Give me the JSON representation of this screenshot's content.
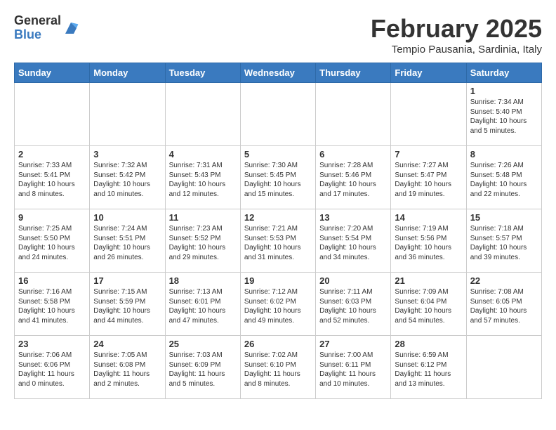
{
  "header": {
    "logo_general": "General",
    "logo_blue": "Blue",
    "month_title": "February 2025",
    "location": "Tempio Pausania, Sardinia, Italy"
  },
  "weekdays": [
    "Sunday",
    "Monday",
    "Tuesday",
    "Wednesday",
    "Thursday",
    "Friday",
    "Saturday"
  ],
  "weeks": [
    [
      {
        "day": "",
        "info": ""
      },
      {
        "day": "",
        "info": ""
      },
      {
        "day": "",
        "info": ""
      },
      {
        "day": "",
        "info": ""
      },
      {
        "day": "",
        "info": ""
      },
      {
        "day": "",
        "info": ""
      },
      {
        "day": "1",
        "info": "Sunrise: 7:34 AM\nSunset: 5:40 PM\nDaylight: 10 hours and 5 minutes."
      }
    ],
    [
      {
        "day": "2",
        "info": "Sunrise: 7:33 AM\nSunset: 5:41 PM\nDaylight: 10 hours and 8 minutes."
      },
      {
        "day": "3",
        "info": "Sunrise: 7:32 AM\nSunset: 5:42 PM\nDaylight: 10 hours and 10 minutes."
      },
      {
        "day": "4",
        "info": "Sunrise: 7:31 AM\nSunset: 5:43 PM\nDaylight: 10 hours and 12 minutes."
      },
      {
        "day": "5",
        "info": "Sunrise: 7:30 AM\nSunset: 5:45 PM\nDaylight: 10 hours and 15 minutes."
      },
      {
        "day": "6",
        "info": "Sunrise: 7:28 AM\nSunset: 5:46 PM\nDaylight: 10 hours and 17 minutes."
      },
      {
        "day": "7",
        "info": "Sunrise: 7:27 AM\nSunset: 5:47 PM\nDaylight: 10 hours and 19 minutes."
      },
      {
        "day": "8",
        "info": "Sunrise: 7:26 AM\nSunset: 5:48 PM\nDaylight: 10 hours and 22 minutes."
      }
    ],
    [
      {
        "day": "9",
        "info": "Sunrise: 7:25 AM\nSunset: 5:50 PM\nDaylight: 10 hours and 24 minutes."
      },
      {
        "day": "10",
        "info": "Sunrise: 7:24 AM\nSunset: 5:51 PM\nDaylight: 10 hours and 26 minutes."
      },
      {
        "day": "11",
        "info": "Sunrise: 7:23 AM\nSunset: 5:52 PM\nDaylight: 10 hours and 29 minutes."
      },
      {
        "day": "12",
        "info": "Sunrise: 7:21 AM\nSunset: 5:53 PM\nDaylight: 10 hours and 31 minutes."
      },
      {
        "day": "13",
        "info": "Sunrise: 7:20 AM\nSunset: 5:54 PM\nDaylight: 10 hours and 34 minutes."
      },
      {
        "day": "14",
        "info": "Sunrise: 7:19 AM\nSunset: 5:56 PM\nDaylight: 10 hours and 36 minutes."
      },
      {
        "day": "15",
        "info": "Sunrise: 7:18 AM\nSunset: 5:57 PM\nDaylight: 10 hours and 39 minutes."
      }
    ],
    [
      {
        "day": "16",
        "info": "Sunrise: 7:16 AM\nSunset: 5:58 PM\nDaylight: 10 hours and 41 minutes."
      },
      {
        "day": "17",
        "info": "Sunrise: 7:15 AM\nSunset: 5:59 PM\nDaylight: 10 hours and 44 minutes."
      },
      {
        "day": "18",
        "info": "Sunrise: 7:13 AM\nSunset: 6:01 PM\nDaylight: 10 hours and 47 minutes."
      },
      {
        "day": "19",
        "info": "Sunrise: 7:12 AM\nSunset: 6:02 PM\nDaylight: 10 hours and 49 minutes."
      },
      {
        "day": "20",
        "info": "Sunrise: 7:11 AM\nSunset: 6:03 PM\nDaylight: 10 hours and 52 minutes."
      },
      {
        "day": "21",
        "info": "Sunrise: 7:09 AM\nSunset: 6:04 PM\nDaylight: 10 hours and 54 minutes."
      },
      {
        "day": "22",
        "info": "Sunrise: 7:08 AM\nSunset: 6:05 PM\nDaylight: 10 hours and 57 minutes."
      }
    ],
    [
      {
        "day": "23",
        "info": "Sunrise: 7:06 AM\nSunset: 6:06 PM\nDaylight: 11 hours and 0 minutes."
      },
      {
        "day": "24",
        "info": "Sunrise: 7:05 AM\nSunset: 6:08 PM\nDaylight: 11 hours and 2 minutes."
      },
      {
        "day": "25",
        "info": "Sunrise: 7:03 AM\nSunset: 6:09 PM\nDaylight: 11 hours and 5 minutes."
      },
      {
        "day": "26",
        "info": "Sunrise: 7:02 AM\nSunset: 6:10 PM\nDaylight: 11 hours and 8 minutes."
      },
      {
        "day": "27",
        "info": "Sunrise: 7:00 AM\nSunset: 6:11 PM\nDaylight: 11 hours and 10 minutes."
      },
      {
        "day": "28",
        "info": "Sunrise: 6:59 AM\nSunset: 6:12 PM\nDaylight: 11 hours and 13 minutes."
      },
      {
        "day": "",
        "info": ""
      }
    ]
  ]
}
